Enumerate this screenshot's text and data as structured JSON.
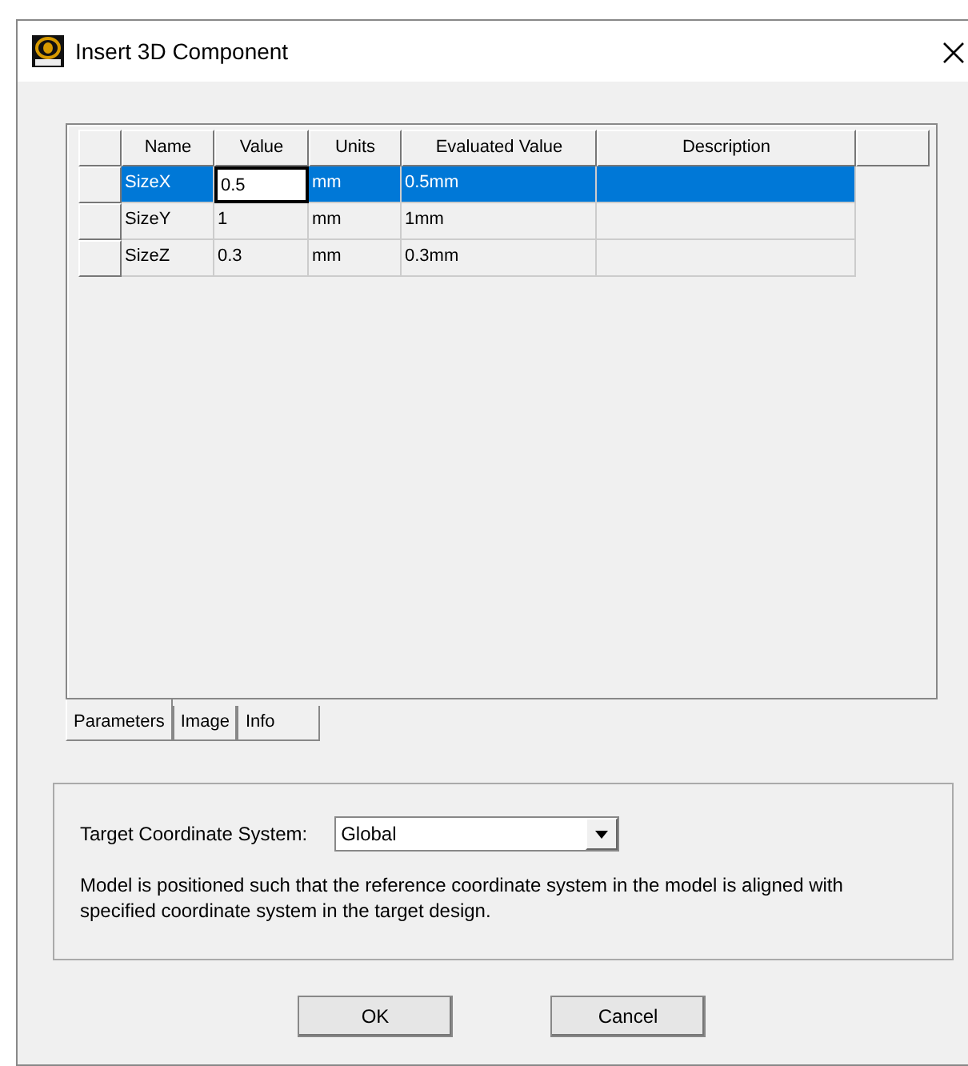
{
  "window": {
    "title": "Insert 3D Component"
  },
  "table": {
    "columns": [
      "Name",
      "Value",
      "Units",
      "Evaluated Value",
      "Description"
    ],
    "rows": [
      {
        "cells": [
          "SizeX",
          "0.5",
          "mm",
          "0.5mm",
          ""
        ],
        "selected": true,
        "editing": true
      },
      {
        "cells": [
          "SizeY",
          "1",
          "mm",
          "1mm",
          ""
        ],
        "selected": false,
        "editing": false
      },
      {
        "cells": [
          "SizeZ",
          "0.3",
          "mm",
          "0.3mm",
          ""
        ],
        "selected": false,
        "editing": false
      }
    ]
  },
  "tabs": [
    {
      "label": "Parameters",
      "selected": true
    },
    {
      "label": "Image",
      "selected": false
    },
    {
      "label": "Info",
      "selected": false
    }
  ],
  "target": {
    "label": "Target Coordinate System:",
    "value": "Global",
    "note": "Model is positioned such that the reference coordinate system in the model is aligned with specified coordinate system in the target design."
  },
  "buttons": [
    "OK",
    "Cancel"
  ]
}
